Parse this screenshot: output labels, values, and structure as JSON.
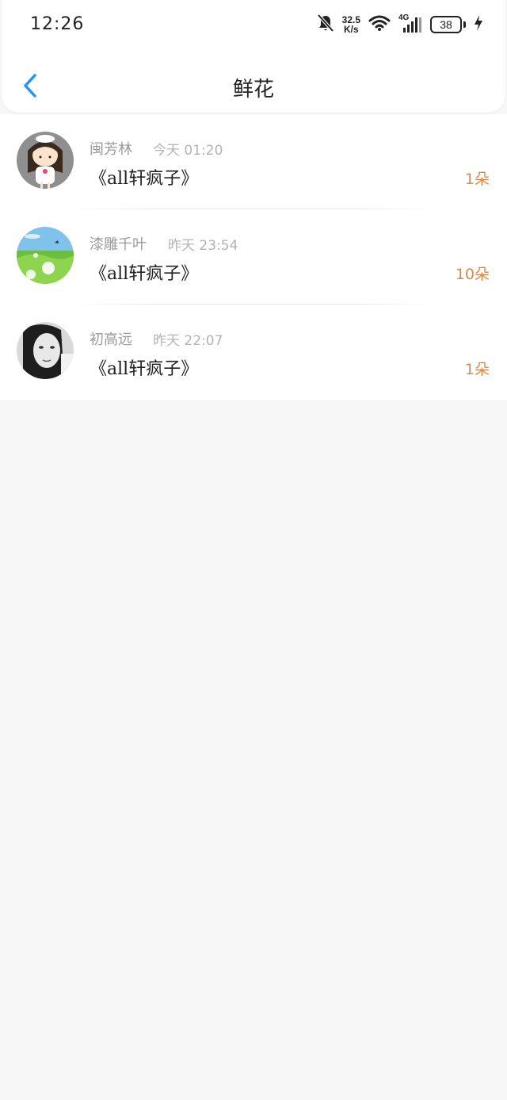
{
  "status_bar": {
    "time": "12:26",
    "net_speed_value": "32.5",
    "net_speed_unit": "K/s",
    "network_type": "4G",
    "battery_level": "38"
  },
  "header": {
    "title": "鲜花"
  },
  "list": {
    "items": [
      {
        "name": "闽芳林",
        "time": "今天 01:20",
        "title": "《all轩疯子》",
        "count": "1朵"
      },
      {
        "name": "漆雕千叶",
        "time": "昨天 23:54",
        "title": "《all轩疯子》",
        "count": "10朵"
      },
      {
        "name": "初高远",
        "time": "昨天 22:07",
        "title": "《all轩疯子》",
        "count": "1朵"
      }
    ]
  },
  "colors": {
    "accent_blue": "#2196f3",
    "count_orange": "#d98a4a",
    "page_background": "#f8f7f8"
  }
}
